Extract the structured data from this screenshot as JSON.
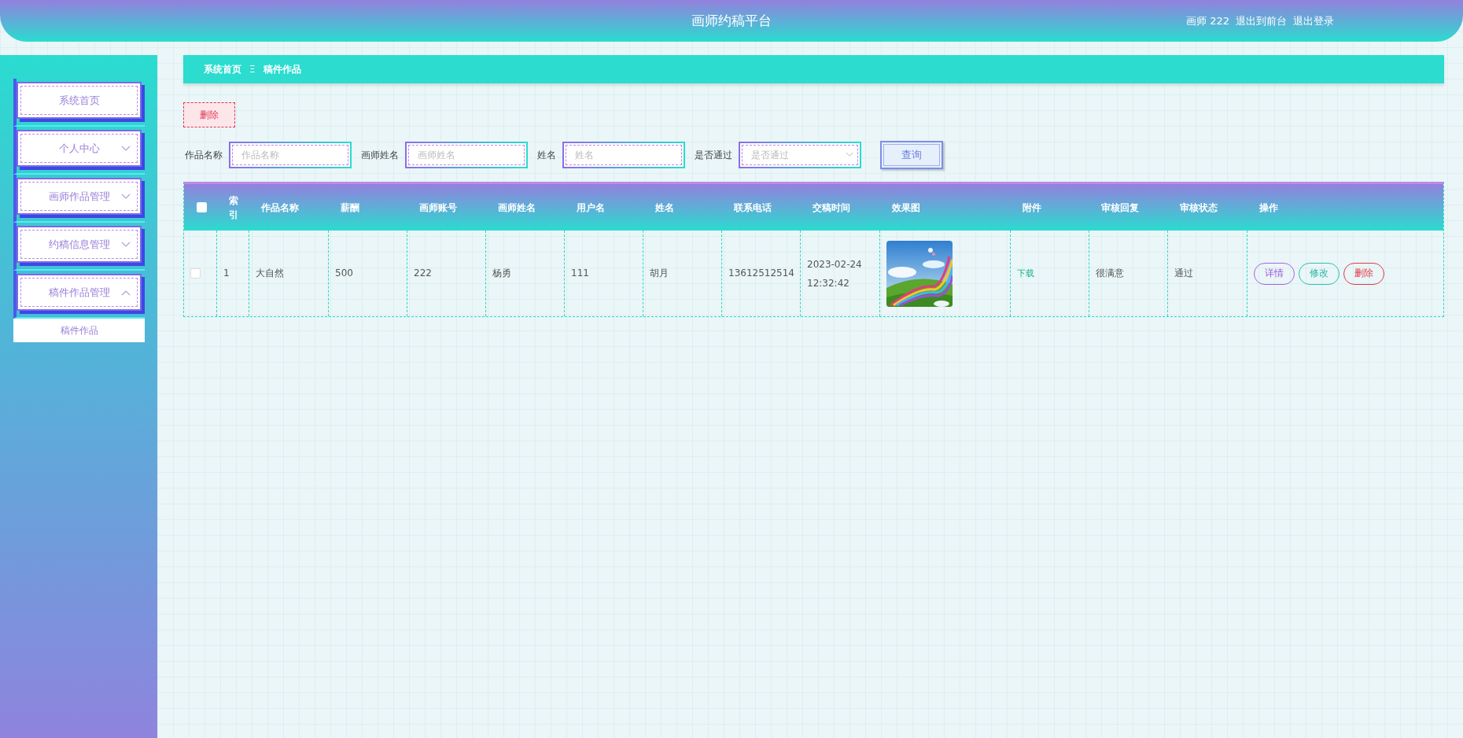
{
  "header": {
    "title": "画师约稿平台",
    "user": "画师 222",
    "links": [
      "退出到前台",
      "退出登录"
    ]
  },
  "sidebar": {
    "items": [
      {
        "label": "系统首页",
        "kind": "link"
      },
      {
        "label": "个人中心",
        "kind": "group",
        "expanded": false
      },
      {
        "label": "画师作品管理",
        "kind": "group",
        "expanded": false
      },
      {
        "label": "约稿信息管理",
        "kind": "group",
        "expanded": false
      },
      {
        "label": "稿件作品管理",
        "kind": "group",
        "expanded": true,
        "children": [
          {
            "label": "稿件作品",
            "selected": true
          }
        ]
      }
    ]
  },
  "breadcrumb": [
    "系统首页",
    "稿件作品"
  ],
  "breadcrumb_separator": "Ξ",
  "delete_button": "删除",
  "filters": [
    {
      "label": "作品名称",
      "placeholder": "作品名称",
      "kind": "input"
    },
    {
      "label": "画师姓名",
      "placeholder": "画师姓名",
      "kind": "input"
    },
    {
      "label": "姓名",
      "placeholder": "姓名",
      "kind": "input"
    },
    {
      "label": "是否通过",
      "placeholder": "是否通过",
      "kind": "select"
    }
  ],
  "search_button": "查询",
  "table": {
    "columns": [
      "索引",
      "作品名称",
      "薪酬",
      "画师账号",
      "画师姓名",
      "用户名",
      "姓名",
      "联系电话",
      "交稿时间",
      "效果图",
      "附件",
      "审核回复",
      "审核状态",
      "操作"
    ],
    "all_checked": false,
    "rows": [
      {
        "checked": false,
        "cells": [
          "1",
          "大自然",
          "500",
          "222",
          "杨勇",
          "111",
          "胡月",
          "13612512514",
          "2023-02-24 12:32:42"
        ],
        "image": {
          "kind": "picture"
        },
        "attachment": "下载",
        "reply": "很满意",
        "status": "通过",
        "actions": [
          {
            "label": "详情",
            "kind": "detail"
          },
          {
            "label": "修改",
            "kind": "edit"
          },
          {
            "label": "删除",
            "kind": "delete"
          }
        ]
      }
    ]
  }
}
